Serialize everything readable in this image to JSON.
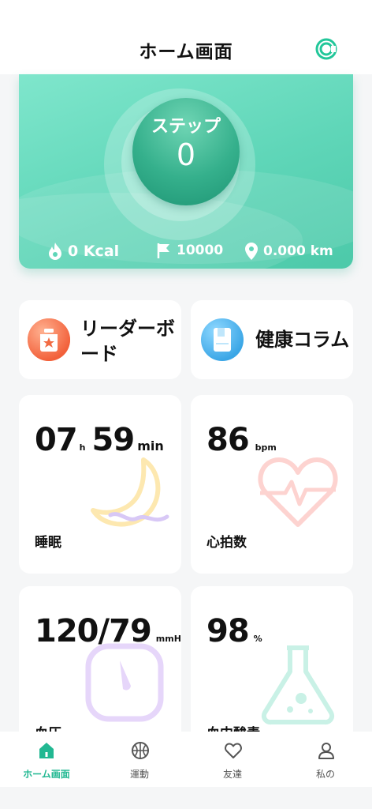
{
  "header": {
    "title": "ホーム画面",
    "ring_icon": "ring-device-icon"
  },
  "hero": {
    "steps_label": "ステップ",
    "steps_value": "0",
    "calories": "0 Kcal",
    "goal": "10000",
    "distance": "0.000 km",
    "accent": "#5fd6b8"
  },
  "features": {
    "leaderboard": "リーダーボード",
    "health_column": "健康コラム"
  },
  "sleep": {
    "hours": "07",
    "h_unit": "h",
    "minutes": "59",
    "min_unit": "min",
    "label": "睡眠"
  },
  "heart": {
    "value": "86",
    "unit": "bpm",
    "label": "心拍数"
  },
  "blood_pressure": {
    "value": "120/79",
    "unit": "mmHg",
    "label": "血圧"
  },
  "oxygen": {
    "value": "98",
    "unit": "%",
    "label": "血中酸素"
  },
  "tabbar": {
    "items": [
      {
        "label": "ホーム画面",
        "icon": "home-icon"
      },
      {
        "label": "運動",
        "icon": "basketball-icon"
      },
      {
        "label": "友達",
        "icon": "heart-icon"
      },
      {
        "label": "私の",
        "icon": "person-icon"
      }
    ],
    "active_color": "#22b892"
  }
}
